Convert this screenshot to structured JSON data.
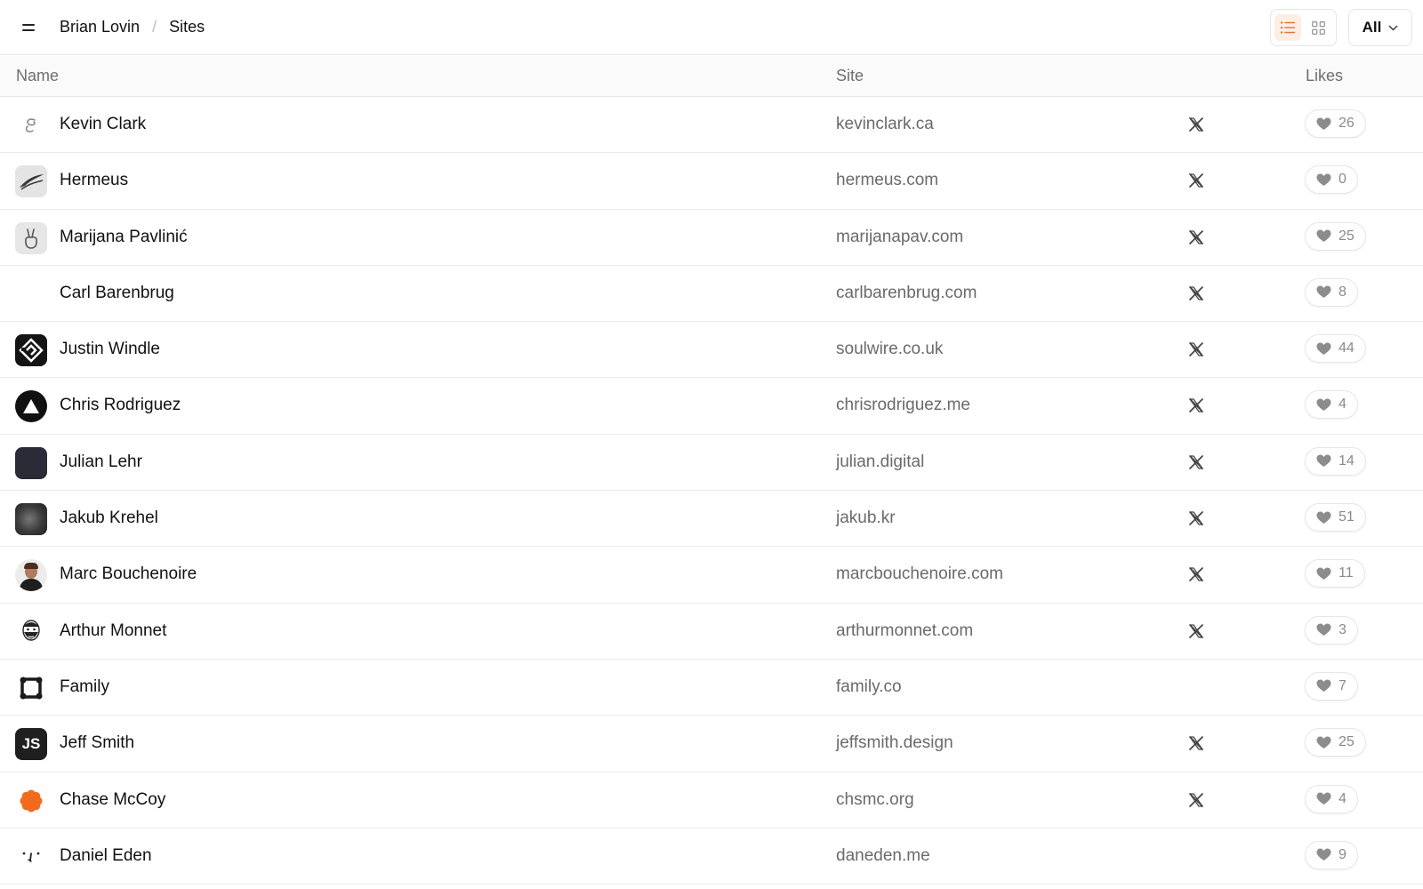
{
  "breadcrumb": {
    "owner": "Brian Lovin",
    "page": "Sites",
    "separator": "/"
  },
  "filter": {
    "label": "All"
  },
  "accent_color": "#ef6c2c",
  "table": {
    "columns": {
      "name": "Name",
      "site": "Site",
      "likes": "Likes"
    },
    "rows": [
      {
        "name": "Kevin Clark",
        "site": "kevinclark.ca",
        "has_x": true,
        "likes": "26",
        "avatar": "squiggle-logo"
      },
      {
        "name": "Hermeus",
        "site": "hermeus.com",
        "has_x": true,
        "likes": "0",
        "avatar": "wing-logo"
      },
      {
        "name": "Marijana Pavlinić",
        "site": "marijanapav.com",
        "has_x": true,
        "likes": "25",
        "avatar": "peace-hand-logo"
      },
      {
        "name": "Carl Barenbrug",
        "site": "carlbarenbrug.com",
        "has_x": true,
        "likes": "8",
        "avatar": "blank"
      },
      {
        "name": "Justin Windle",
        "site": "soulwire.co.uk",
        "has_x": true,
        "likes": "44",
        "avatar": "soulwire-logo"
      },
      {
        "name": "Chris Rodriguez",
        "site": "chrisrodriguez.me",
        "has_x": true,
        "likes": "4",
        "avatar": "triangle-logo"
      },
      {
        "name": "Julian Lehr",
        "site": "julian.digital",
        "has_x": true,
        "likes": "14",
        "avatar": "dark-square"
      },
      {
        "name": "Jakub Krehel",
        "site": "jakub.kr",
        "has_x": true,
        "likes": "51",
        "avatar": "blur-gradient"
      },
      {
        "name": "Marc Bouchenoire",
        "site": "marcbouchenoire.com",
        "has_x": true,
        "likes": "11",
        "avatar": "photo-portrait"
      },
      {
        "name": "Arthur Monnet",
        "site": "arthurmonnet.com",
        "has_x": true,
        "likes": "3",
        "avatar": "bearded-face-sketch"
      },
      {
        "name": "Family",
        "site": "family.co",
        "has_x": false,
        "likes": "7",
        "avatar": "family-logo"
      },
      {
        "name": "Jeff Smith",
        "site": "jeffsmith.design",
        "has_x": true,
        "likes": "25",
        "avatar": "js-logo",
        "avatar_text": "JS"
      },
      {
        "name": "Chase McCoy",
        "site": "chsmc.org",
        "has_x": true,
        "likes": "4",
        "avatar": "orange-flower"
      },
      {
        "name": "Daniel Eden",
        "site": "daneden.me",
        "has_x": false,
        "likes": "9",
        "avatar": "dots-logo"
      }
    ]
  }
}
